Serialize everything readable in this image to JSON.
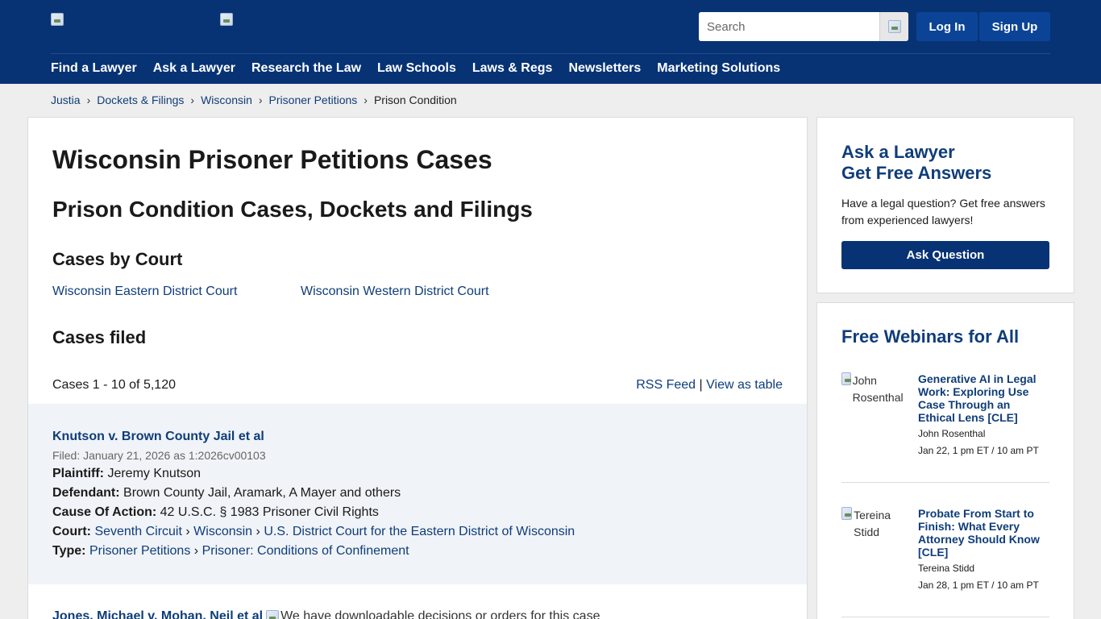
{
  "header": {
    "search_placeholder": "Search",
    "login_label": "Log In",
    "signup_label": "Sign Up",
    "nav": [
      "Find a Lawyer",
      "Ask a Lawyer",
      "Research the Law",
      "Law Schools",
      "Laws & Regs",
      "Newsletters",
      "Marketing Solutions"
    ]
  },
  "breadcrumb": {
    "items": [
      "Justia",
      "Dockets & Filings",
      "Wisconsin",
      "Prisoner Petitions"
    ],
    "current": "Prison Condition",
    "separator": "›"
  },
  "main": {
    "title": "Wisconsin Prisoner Petitions Cases",
    "subtitle": "Prison Condition Cases, Dockets and Filings",
    "cases_by_court_heading": "Cases by Court",
    "courts": [
      "Wisconsin Eastern District Court",
      "Wisconsin Western District Court"
    ],
    "cases_filed_heading": "Cases filed",
    "count_text": "Cases 1 - 10 of 5,120",
    "rss_label": "RSS Feed",
    "rss_separator": "|",
    "view_table_label": "View as table",
    "case1": {
      "title": "Knutson v. Brown County Jail et al",
      "filed": "Filed: January 21, 2026 as 1:2026cv00103",
      "plaintiff_label": "Plaintiff:",
      "plaintiff": "Jeremy Knutson",
      "defendant_label": "Defendant:",
      "defendant": "Brown County Jail, Aramark, A Mayer and others",
      "cause_label": "Cause Of Action:",
      "cause": "42 U.S.C. § 1983 Prisoner Civil Rights",
      "court_label": "Court:",
      "court_path": [
        "Seventh Circuit",
        "Wisconsin",
        "U.S. District Court for the Eastern District of Wisconsin"
      ],
      "type_label": "Type:",
      "type_path": [
        "Prisoner Petitions",
        "Prisoner: Conditions of Confinement"
      ],
      "path_separator": "›"
    },
    "case2": {
      "title": "Jones, Michael v. Mohan, Neil et al",
      "img_alt": "We have downloadable decisions or orders for this case"
    }
  },
  "sidebar": {
    "ask_heading_1": "Ask a Lawyer",
    "ask_heading_2": "Get Free Answers",
    "ask_text": "Have a legal question? Get free answers from experienced lawyers!",
    "ask_button": "Ask Question",
    "webinars_heading": "Free Webinars for All",
    "webinars": [
      {
        "photo_alt": "John Rosenthal",
        "title": "Generative AI in Legal Work: Exploring Use Case Through an Ethical Lens [CLE]",
        "presenter": "John Rosenthal",
        "date": "Jan 22, 1 pm ET / 10 am PT"
      },
      {
        "photo_alt": "Tereina Stidd",
        "title": "Probate From Start to Finish: What Every Attorney Should Know [CLE]",
        "presenter": "Tereina Stidd",
        "date": "Jan 28, 1 pm ET / 10 am PT"
      }
    ]
  },
  "colors": {
    "header_bg": "#073374",
    "button_bg": "#0b4497",
    "link": "#0f3d79",
    "page_bg": "#eeeeee",
    "case_block_bg": "#f0f3f7"
  },
  "icons": [
    "broken-image-icon"
  ]
}
